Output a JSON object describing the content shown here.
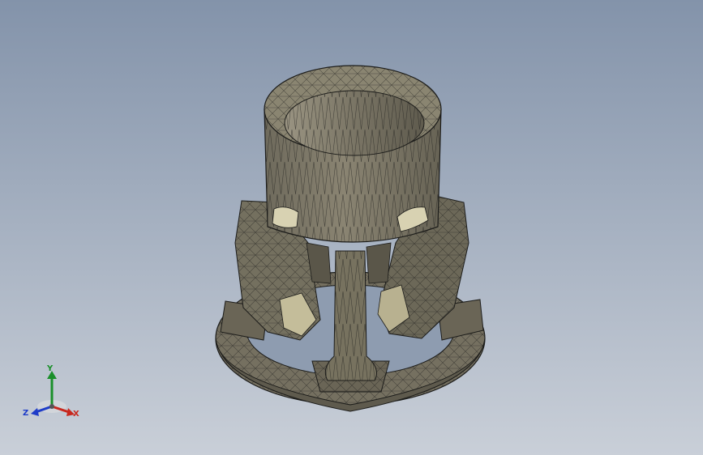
{
  "viewport": {
    "background_top": "#8393aa",
    "background_bottom": "#c9cfd8",
    "model_color": "#7f7a6a",
    "edge_color": "#1c1c1a",
    "highlight_color": "#e8e2c4"
  },
  "triad": {
    "x_label": "X",
    "y_label": "Y",
    "z_label": "Z",
    "x_color": "#c8281e",
    "y_color": "#1a8f2a",
    "z_color": "#1e3cc8"
  }
}
